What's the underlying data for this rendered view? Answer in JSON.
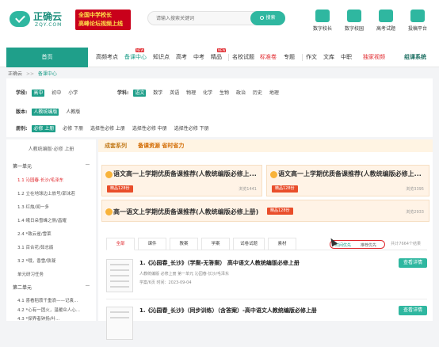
{
  "header": {
    "logo_name": "正确云",
    "logo_sub": "ZQY.COM",
    "banner_line1": "全国中学校长",
    "banner_line2": "高峰论坛视频上线",
    "search_placeholder": "请输入搜索关键词",
    "search_button": "搜索",
    "icons": [
      "数字校长",
      "数字校园",
      "高考试题",
      "投稿平台"
    ]
  },
  "nav": {
    "home": "首页",
    "items": [
      "高频考点",
      "备课中心",
      "知识点",
      "高考",
      "中考",
      "精品",
      "名校试题",
      "标准卷",
      "专题",
      "作文",
      "文库",
      "中职",
      "独家视频"
    ],
    "right_label": "组课系统",
    "new_badge": "NEW"
  },
  "breadcrumb": {
    "root": "正确云",
    "sep": ">>",
    "current": "备课中心"
  },
  "filters": {
    "stage_label": "学段:",
    "stages": [
      "高中",
      "初中",
      "小学"
    ],
    "subject_label": "学科:",
    "subjects": [
      "语文",
      "数学",
      "英语",
      "物理",
      "化学",
      "生物",
      "政治",
      "历史",
      "地理"
    ],
    "version_label": "版本:",
    "versions": [
      "人教统编版",
      "人教版"
    ],
    "book_label": "册别:",
    "books": [
      "必修 上册",
      "必修 下册",
      "选择性必修 上册",
      "选择性必修 中册",
      "选择性必修 下册"
    ]
  },
  "sidebar": {
    "title": "人教统编版·必修 上册",
    "units": [
      {
        "name": "第一单元",
        "lessons": [
          "1.1 沁园春·长沙/毛泽东",
          "1.2 立在地球边上放号/郭沫若",
          "1.3 红烛/闻一多",
          "1.4 峨日朵雪峰之侧/昌耀",
          "2.4 *致云雀/雪莱",
          "3.1 百合花/茹志鹃",
          "3.2 *哦，香雪/铁凝",
          "单元研习任务"
        ]
      },
      {
        "name": "第二单元",
        "lessons": [
          "4.1 喜看稻菽千重浪——记袁...",
          "4.2 *心有一团火，温暖众人心...",
          "4.3 *探界者钟扬/叶..."
        ]
      }
    ]
  },
  "main": {
    "header_a": "成套系列",
    "header_b": "备课资源 省时省力",
    "cards": [
      {
        "title": "语文高一上学期优质备课推荐(人教统编版必修上...",
        "tag": "精品128份",
        "views": "浏览1441"
      },
      {
        "title": "语文高一上学期优质备课推荐(人教统编版必修上...",
        "tag": "精品128份",
        "views": "浏览3395"
      },
      {
        "title": "高一语文上学期优质备课推荐(人教统编版必修上册)",
        "tag": "精品128份",
        "views": "浏览2933"
      }
    ],
    "tabs": [
      "全部",
      "课件",
      "教案",
      "学案",
      "试卷试题",
      "素材"
    ],
    "sort": [
      "时间优先",
      "推荐优先"
    ],
    "result_count": "共计7664个结果",
    "results": [
      {
        "title": "1.《沁园春_长沙》（学案-无答案） 高中语文人教统编版必修上册",
        "meta1": "人教统编版    必修上册    第一单元    沁园春·长沙/毛泽东",
        "meta2": "学案/6页    时间：2023-09-04",
        "button": "查看详情"
      },
      {
        "title": "1.《沁园春_长沙》（同步训练）（含答案）-高中语文人教统编版必修上册",
        "button": "查看详情"
      }
    ]
  }
}
